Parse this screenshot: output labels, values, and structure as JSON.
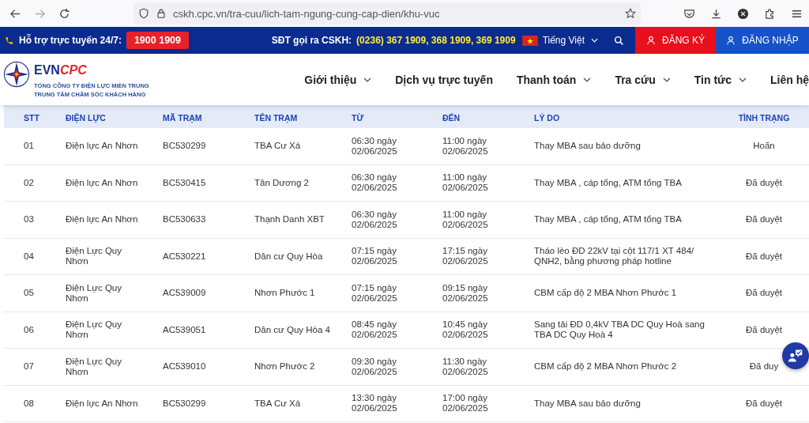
{
  "browser": {
    "url": "cskh.cpc.vn/tra-cuu/lich-tam-ngung-cung-cap-dien/khu-vuc"
  },
  "top_bar": {
    "support_label": "Hỗ trợ trực tuyến 24/7:",
    "hotline": "1900 1909",
    "cskh_label": "SĐT gọi ra CSKH:",
    "cskh_numbers": "(0236) 367 1909, 368 1909, 369 1909",
    "language": "Tiếng Việt",
    "register": "ĐĂNG KÝ",
    "login": "ĐĂNG NHẬP"
  },
  "logo": {
    "brand": "EVN",
    "brand_accent": "CPC",
    "line_1": "TỔNG CÔNG TY ĐIỆN LỰC MIỀN TRUNG",
    "line_2": "TRUNG TÂM CHĂM SÓC KHÁCH HÀNG"
  },
  "nav": [
    {
      "label": "Giới thiệu",
      "dropdown": true
    },
    {
      "label": "Dịch vụ trực tuyến",
      "dropdown": false
    },
    {
      "label": "Thanh toán",
      "dropdown": true
    },
    {
      "label": "Tra cứu",
      "dropdown": true
    },
    {
      "label": "Tin tức",
      "dropdown": true
    },
    {
      "label": "Liên hệ",
      "dropdown": false
    }
  ],
  "table": {
    "columns": [
      "STT",
      "ĐIỆN LỰC",
      "MÃ TRẠM",
      "TÊN TRẠM",
      "TỪ",
      "ĐẾN",
      "LÝ DO",
      "TÌNH TRẠNG"
    ],
    "rows": [
      [
        "01",
        "Điện lực An Nhơn",
        "BC530299",
        "TBA Cư Xá",
        "06:30 ngày 02/06/2025",
        "11:00 ngày 02/06/2025",
        "Thay MBA sau bảo dưỡng",
        "Hoãn"
      ],
      [
        "02",
        "Điện lực An Nhơn",
        "BC530415",
        "Tân Dương 2",
        "06:30 ngày 02/06/2025",
        "11:00 ngày 02/06/2025",
        "Thay MBA , cáp tổng, ATM tổng TBA",
        "Đã duyệt"
      ],
      [
        "03",
        "Điện lực An Nhơn",
        "BC530633",
        "Thạnh Danh XBT",
        "06:30 ngày 02/06/2025",
        "11:00 ngày 02/06/2025",
        "Thay MBA , cáp tổng, ATM tổng TBA",
        "Đã duyệt"
      ],
      [
        "04",
        "Điện Lực Quy Nhơn",
        "AC530221",
        "Dân cư Quy Hòa",
        "07:15 ngày 02/06/2025",
        "17:15 ngày 02/06/2025",
        "Tháo lèo ĐD 22kV tại cột 117/1 XT 484/ QNH2, bằng phương pháp hotline",
        "Đã duyệt"
      ],
      [
        "05",
        "Điện Lực Quy Nhơn",
        "AC539009",
        "Nhơn Phước 1",
        "07:15 ngày 02/06/2025",
        "09:15 ngày 02/06/2025",
        "CBM cấp độ 2 MBA Nhơn Phước 1",
        "Đã duyệt"
      ],
      [
        "06",
        "Điện Lực Quy Nhơn",
        "AC539051",
        "Dân cư Quy Hòa 4",
        "08:45 ngày 02/06/2025",
        "10:45 ngày 02/06/2025",
        "Sang tải ĐD 0,4kV TBA DC Quy Hoà sang TBA DC Quy Hoà 4",
        "Đã duyệt"
      ],
      [
        "07",
        "Điện Lực Quy Nhơn",
        "AC539010",
        "Nhơn Phước 2",
        "09:30 ngày 02/06/2025",
        "11:30 ngày 02/06/2025",
        "CBM cấp độ 2 MBA Nhơn Phước 2",
        "Đã duy"
      ],
      [
        "08",
        "Điện lực An Nhơn",
        "BC530299",
        "TBA Cư Xá",
        "13:30 ngày 02/06/2025",
        "17:00 ngày 02/06/2025",
        "Thay MBA sau bảo dưỡng",
        "Đã duyệt"
      ]
    ]
  }
}
